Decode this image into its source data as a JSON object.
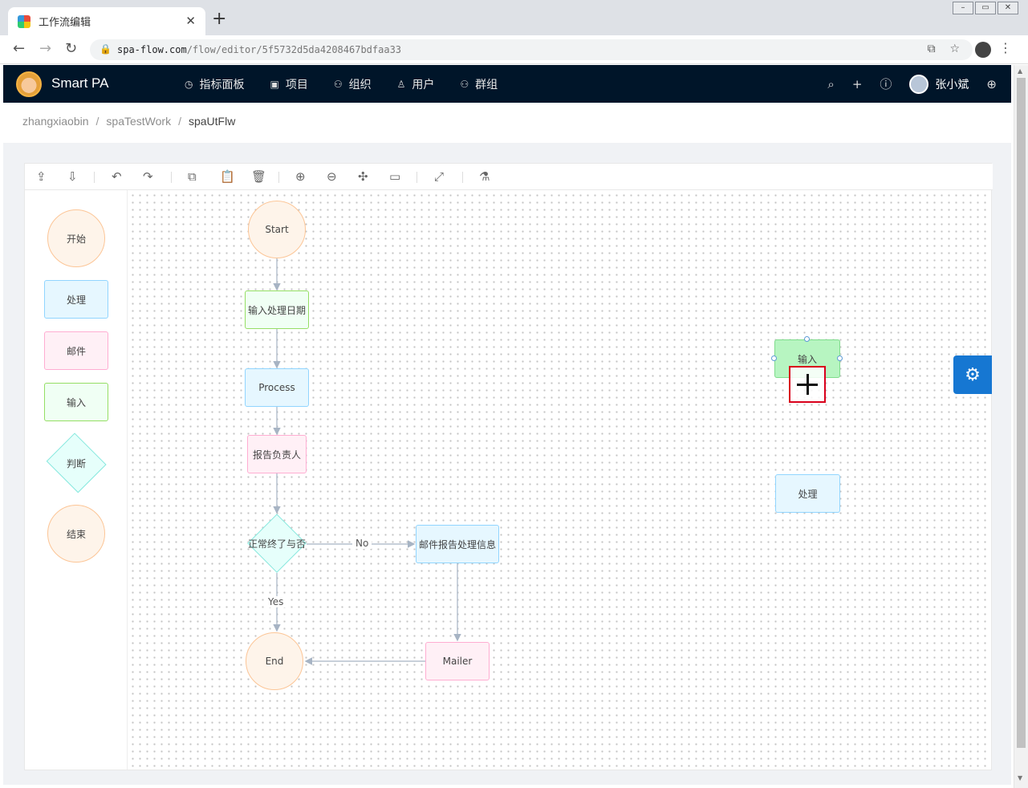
{
  "browser": {
    "tab_title": "工作流编辑",
    "tab_close": "✕",
    "new_tab": "+",
    "url_host": "spa-flow.com",
    "url_path": "/flow/editor/5f5732d5da4208467bdfaa33"
  },
  "app": {
    "brand": "Smart PA",
    "menu": [
      {
        "icon": "dashboard-icon",
        "glyph": "◷",
        "label": "指标面板"
      },
      {
        "icon": "project-icon",
        "glyph": "▣",
        "label": "项目"
      },
      {
        "icon": "org-icon",
        "glyph": "⚇",
        "label": "组织"
      },
      {
        "icon": "user-icon",
        "glyph": "♙",
        "label": "用户"
      },
      {
        "icon": "group-icon",
        "glyph": "⚇",
        "label": "群组"
      }
    ],
    "user_name": "张小斌"
  },
  "breadcrumb": [
    "zhangxiaobin",
    "spaTestWork",
    "spaUtFlw"
  ],
  "palette": {
    "start": "开始",
    "process": "处理",
    "mail": "邮件",
    "input": "输入",
    "decision": "判断",
    "end": "结束"
  },
  "flow": {
    "start": "Start",
    "input_date": "输入处理日期",
    "process": "Process",
    "report_owner": "报告负责人",
    "decision": "正常终了与否",
    "no_label": "No",
    "mail_info": "邮件报告处理信息",
    "yes_label": "Yes",
    "end": "End",
    "mailer": "Mailer",
    "dragging_input": "输入",
    "dropped_process": "处理"
  },
  "colors": {
    "header_bg": "#001529",
    "accent": "#1677d2",
    "highlight": "#d9001b"
  }
}
